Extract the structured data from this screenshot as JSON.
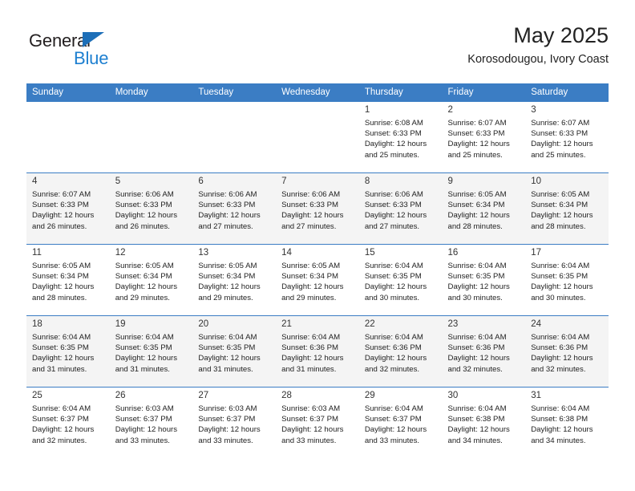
{
  "brand": {
    "word_general": "General",
    "word_blue": "Blue",
    "triangle_color": "#1d6fb8"
  },
  "header": {
    "title": "May 2025",
    "subtitle": "Korosodougou, Ivory Coast",
    "accent_color": "#3b7dc4"
  },
  "weekdays": [
    "Sunday",
    "Monday",
    "Tuesday",
    "Wednesday",
    "Thursday",
    "Friday",
    "Saturday"
  ],
  "labels": {
    "sunrise_prefix": "Sunrise:",
    "sunset_prefix": "Sunset:",
    "daylight_prefix": "Daylight:"
  },
  "weeks": [
    {
      "shaded": false,
      "days": [
        {
          "empty": true
        },
        {
          "empty": true
        },
        {
          "empty": true
        },
        {
          "empty": true
        },
        {
          "num": "1",
          "sunrise": "Sunrise: 6:08 AM",
          "sunset": "Sunset: 6:33 PM",
          "daylight1": "Daylight: 12 hours",
          "daylight2": "and 25 minutes."
        },
        {
          "num": "2",
          "sunrise": "Sunrise: 6:07 AM",
          "sunset": "Sunset: 6:33 PM",
          "daylight1": "Daylight: 12 hours",
          "daylight2": "and 25 minutes."
        },
        {
          "num": "3",
          "sunrise": "Sunrise: 6:07 AM",
          "sunset": "Sunset: 6:33 PM",
          "daylight1": "Daylight: 12 hours",
          "daylight2": "and 25 minutes."
        }
      ]
    },
    {
      "shaded": true,
      "days": [
        {
          "num": "4",
          "sunrise": "Sunrise: 6:07 AM",
          "sunset": "Sunset: 6:33 PM",
          "daylight1": "Daylight: 12 hours",
          "daylight2": "and 26 minutes."
        },
        {
          "num": "5",
          "sunrise": "Sunrise: 6:06 AM",
          "sunset": "Sunset: 6:33 PM",
          "daylight1": "Daylight: 12 hours",
          "daylight2": "and 26 minutes."
        },
        {
          "num": "6",
          "sunrise": "Sunrise: 6:06 AM",
          "sunset": "Sunset: 6:33 PM",
          "daylight1": "Daylight: 12 hours",
          "daylight2": "and 27 minutes."
        },
        {
          "num": "7",
          "sunrise": "Sunrise: 6:06 AM",
          "sunset": "Sunset: 6:33 PM",
          "daylight1": "Daylight: 12 hours",
          "daylight2": "and 27 minutes."
        },
        {
          "num": "8",
          "sunrise": "Sunrise: 6:06 AM",
          "sunset": "Sunset: 6:33 PM",
          "daylight1": "Daylight: 12 hours",
          "daylight2": "and 27 minutes."
        },
        {
          "num": "9",
          "sunrise": "Sunrise: 6:05 AM",
          "sunset": "Sunset: 6:34 PM",
          "daylight1": "Daylight: 12 hours",
          "daylight2": "and 28 minutes."
        },
        {
          "num": "10",
          "sunrise": "Sunrise: 6:05 AM",
          "sunset": "Sunset: 6:34 PM",
          "daylight1": "Daylight: 12 hours",
          "daylight2": "and 28 minutes."
        }
      ]
    },
    {
      "shaded": false,
      "days": [
        {
          "num": "11",
          "sunrise": "Sunrise: 6:05 AM",
          "sunset": "Sunset: 6:34 PM",
          "daylight1": "Daylight: 12 hours",
          "daylight2": "and 28 minutes."
        },
        {
          "num": "12",
          "sunrise": "Sunrise: 6:05 AM",
          "sunset": "Sunset: 6:34 PM",
          "daylight1": "Daylight: 12 hours",
          "daylight2": "and 29 minutes."
        },
        {
          "num": "13",
          "sunrise": "Sunrise: 6:05 AM",
          "sunset": "Sunset: 6:34 PM",
          "daylight1": "Daylight: 12 hours",
          "daylight2": "and 29 minutes."
        },
        {
          "num": "14",
          "sunrise": "Sunrise: 6:05 AM",
          "sunset": "Sunset: 6:34 PM",
          "daylight1": "Daylight: 12 hours",
          "daylight2": "and 29 minutes."
        },
        {
          "num": "15",
          "sunrise": "Sunrise: 6:04 AM",
          "sunset": "Sunset: 6:35 PM",
          "daylight1": "Daylight: 12 hours",
          "daylight2": "and 30 minutes."
        },
        {
          "num": "16",
          "sunrise": "Sunrise: 6:04 AM",
          "sunset": "Sunset: 6:35 PM",
          "daylight1": "Daylight: 12 hours",
          "daylight2": "and 30 minutes."
        },
        {
          "num": "17",
          "sunrise": "Sunrise: 6:04 AM",
          "sunset": "Sunset: 6:35 PM",
          "daylight1": "Daylight: 12 hours",
          "daylight2": "and 30 minutes."
        }
      ]
    },
    {
      "shaded": true,
      "days": [
        {
          "num": "18",
          "sunrise": "Sunrise: 6:04 AM",
          "sunset": "Sunset: 6:35 PM",
          "daylight1": "Daylight: 12 hours",
          "daylight2": "and 31 minutes."
        },
        {
          "num": "19",
          "sunrise": "Sunrise: 6:04 AM",
          "sunset": "Sunset: 6:35 PM",
          "daylight1": "Daylight: 12 hours",
          "daylight2": "and 31 minutes."
        },
        {
          "num": "20",
          "sunrise": "Sunrise: 6:04 AM",
          "sunset": "Sunset: 6:35 PM",
          "daylight1": "Daylight: 12 hours",
          "daylight2": "and 31 minutes."
        },
        {
          "num": "21",
          "sunrise": "Sunrise: 6:04 AM",
          "sunset": "Sunset: 6:36 PM",
          "daylight1": "Daylight: 12 hours",
          "daylight2": "and 31 minutes."
        },
        {
          "num": "22",
          "sunrise": "Sunrise: 6:04 AM",
          "sunset": "Sunset: 6:36 PM",
          "daylight1": "Daylight: 12 hours",
          "daylight2": "and 32 minutes."
        },
        {
          "num": "23",
          "sunrise": "Sunrise: 6:04 AM",
          "sunset": "Sunset: 6:36 PM",
          "daylight1": "Daylight: 12 hours",
          "daylight2": "and 32 minutes."
        },
        {
          "num": "24",
          "sunrise": "Sunrise: 6:04 AM",
          "sunset": "Sunset: 6:36 PM",
          "daylight1": "Daylight: 12 hours",
          "daylight2": "and 32 minutes."
        }
      ]
    },
    {
      "shaded": false,
      "days": [
        {
          "num": "25",
          "sunrise": "Sunrise: 6:04 AM",
          "sunset": "Sunset: 6:37 PM",
          "daylight1": "Daylight: 12 hours",
          "daylight2": "and 32 minutes."
        },
        {
          "num": "26",
          "sunrise": "Sunrise: 6:03 AM",
          "sunset": "Sunset: 6:37 PM",
          "daylight1": "Daylight: 12 hours",
          "daylight2": "and 33 minutes."
        },
        {
          "num": "27",
          "sunrise": "Sunrise: 6:03 AM",
          "sunset": "Sunset: 6:37 PM",
          "daylight1": "Daylight: 12 hours",
          "daylight2": "and 33 minutes."
        },
        {
          "num": "28",
          "sunrise": "Sunrise: 6:03 AM",
          "sunset": "Sunset: 6:37 PM",
          "daylight1": "Daylight: 12 hours",
          "daylight2": "and 33 minutes."
        },
        {
          "num": "29",
          "sunrise": "Sunrise: 6:04 AM",
          "sunset": "Sunset: 6:37 PM",
          "daylight1": "Daylight: 12 hours",
          "daylight2": "and 33 minutes."
        },
        {
          "num": "30",
          "sunrise": "Sunrise: 6:04 AM",
          "sunset": "Sunset: 6:38 PM",
          "daylight1": "Daylight: 12 hours",
          "daylight2": "and 34 minutes."
        },
        {
          "num": "31",
          "sunrise": "Sunrise: 6:04 AM",
          "sunset": "Sunset: 6:38 PM",
          "daylight1": "Daylight: 12 hours",
          "daylight2": "and 34 minutes."
        }
      ]
    }
  ]
}
